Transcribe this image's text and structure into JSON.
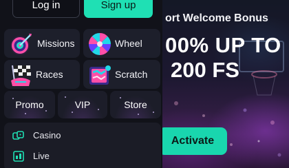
{
  "auth": {
    "login_label": "Log in",
    "signup_label": "Sign up"
  },
  "tiles": {
    "missions": {
      "label": "Missions",
      "icon": "dartboard-icon"
    },
    "wheel": {
      "label": "Wheel",
      "icon": "prize-wheel-icon"
    },
    "races": {
      "label": "Races",
      "icon": "race-flag-icon"
    },
    "scratch": {
      "label": "Scratch",
      "icon": "scratch-card-icon"
    }
  },
  "small_tiles": {
    "promo": "Promo",
    "vip": "VIP",
    "store": "Store"
  },
  "nav_list": [
    {
      "label": "Casino",
      "icon": "casino-icon"
    },
    {
      "label": "Live",
      "icon": "live-icon"
    }
  ],
  "banner": {
    "kicker": "ort Welcome Bonus",
    "headline_line1": "00% UP TO",
    "headline_line2": "200 FS",
    "cta_label": "Activate"
  },
  "colors": {
    "accent": "#1fe0b4",
    "panel_bg": "#111219",
    "tile_bg": "#1d1f2b",
    "banner_cta": "#19d6ae"
  }
}
